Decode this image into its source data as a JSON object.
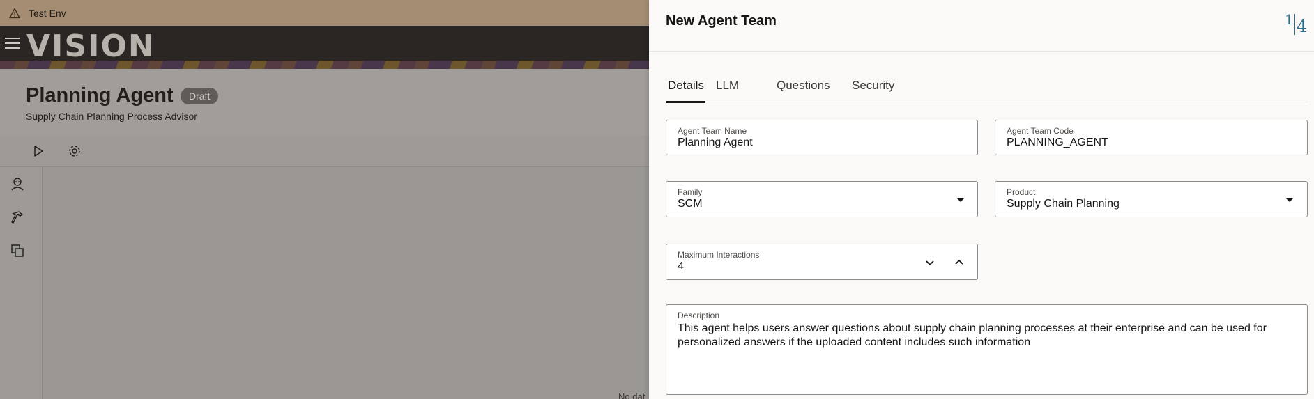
{
  "env_bar": {
    "label": "Test Env"
  },
  "brand": {
    "logo_text": "VISION"
  },
  "page": {
    "title": "Planning Agent",
    "badge": "Draft",
    "subtitle": "Supply Chain Planning Process Advisor",
    "empty_text": "No dat"
  },
  "drawer": {
    "title": "New Agent Team",
    "help_numbers": {
      "first": "1",
      "second": "4"
    },
    "tabs": [
      {
        "label": "Details",
        "active": true
      },
      {
        "label": "LLM",
        "active": false
      },
      {
        "label": "Questions",
        "active": false
      },
      {
        "label": "Security",
        "active": false
      }
    ],
    "fields": {
      "team_name": {
        "label": "Agent Team Name",
        "value": "Planning Agent"
      },
      "team_code": {
        "label": "Agent Team Code",
        "value": "PLANNING_AGENT"
      },
      "family": {
        "label": "Family",
        "value": "SCM"
      },
      "product": {
        "label": "Product",
        "value": "Supply Chain Planning"
      },
      "max_interactions": {
        "label": "Maximum Interactions",
        "value": "4"
      },
      "description": {
        "label": "Description",
        "value": "This agent helps users answer questions about supply chain planning processes at their enterprise and can be used for personalized answers if the uploaded content includes such information"
      }
    }
  },
  "colors": {
    "brand_bar": "#2a2623",
    "env_bar": "#a48d72",
    "help_accent": "#2c6d8c"
  }
}
